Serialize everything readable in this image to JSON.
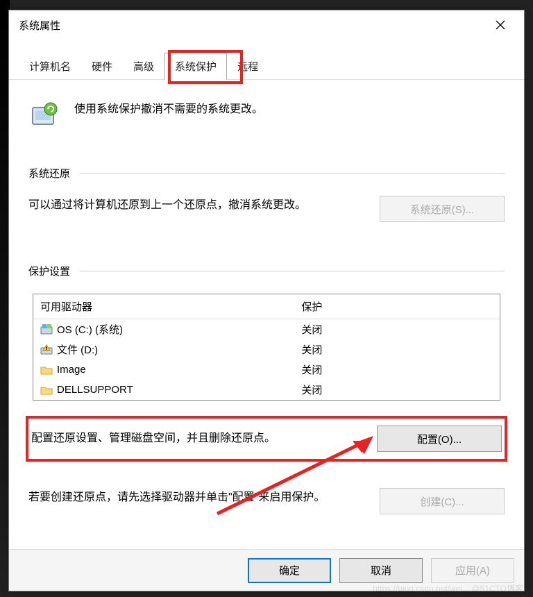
{
  "window": {
    "title": "系统属性",
    "close_icon": "close"
  },
  "tabs": [
    {
      "label": "计算机名",
      "active": false
    },
    {
      "label": "硬件",
      "active": false
    },
    {
      "label": "高级",
      "active": false
    },
    {
      "label": "系统保护",
      "active": true
    },
    {
      "label": "远程",
      "active": false
    }
  ],
  "intro": {
    "text": "使用系统保护撤消不需要的系统更改。"
  },
  "restore_section": {
    "title": "系统还原",
    "desc": "可以通过将计算机还原到上一个还原点，撤消系统更改。",
    "button": "系统还原(S)..."
  },
  "protection_section": {
    "title": "保护设置",
    "table": {
      "headers": {
        "drive": "可用驱动器",
        "protection": "保护"
      },
      "rows": [
        {
          "icon": "drive-windows",
          "name": "OS (C:) (系统)",
          "protection": "关闭"
        },
        {
          "icon": "drive-warning",
          "name": "文件 (D:)",
          "protection": "关闭"
        },
        {
          "icon": "folder",
          "name": "Image",
          "protection": "关闭"
        },
        {
          "icon": "folder",
          "name": "DELLSUPPORT",
          "protection": "关闭"
        }
      ]
    }
  },
  "configure_row": {
    "desc": "配置还原设置、管理磁盘空间，并且删除还原点。",
    "button": "配置(O)..."
  },
  "create_row": {
    "desc": "若要创建还原点，请先选择驱动器并单击\"配置\"来启用保护。",
    "button": "创建(C)..."
  },
  "footer": {
    "ok": "确定",
    "cancel": "取消",
    "apply": "应用(A)"
  },
  "annotations": {
    "highlight_tab": "系统保护",
    "highlight_config": true,
    "arrow_to_config": true
  },
  "watermark": "https://blog.csdn.net/wei... @51CTO博客"
}
